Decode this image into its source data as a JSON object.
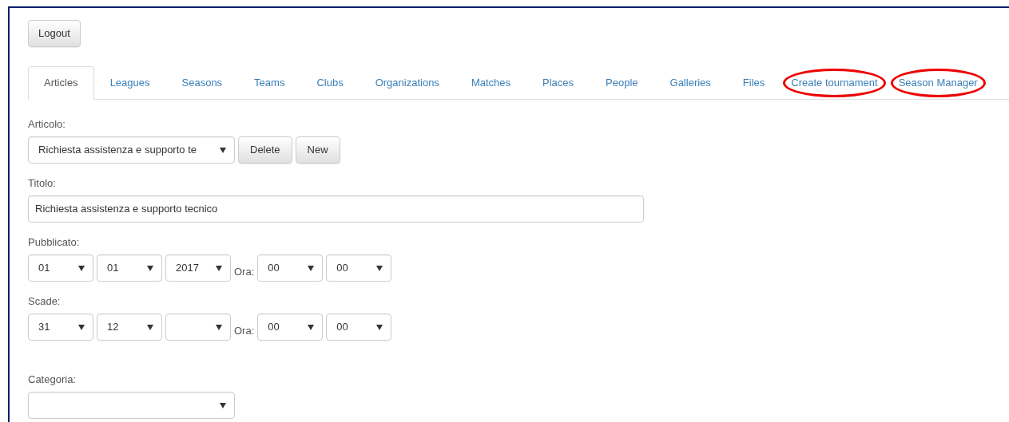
{
  "logout_button": {
    "label": "Logout"
  },
  "tabs": [
    {
      "label": "Articles",
      "selected": true,
      "highlighted": false
    },
    {
      "label": "Leagues",
      "selected": false,
      "highlighted": false
    },
    {
      "label": "Seasons",
      "selected": false,
      "highlighted": false
    },
    {
      "label": "Teams",
      "selected": false,
      "highlighted": false
    },
    {
      "label": "Clubs",
      "selected": false,
      "highlighted": false
    },
    {
      "label": "Organizations",
      "selected": false,
      "highlighted": false
    },
    {
      "label": "Matches",
      "selected": false,
      "highlighted": false
    },
    {
      "label": "Places",
      "selected": false,
      "highlighted": false
    },
    {
      "label": "People",
      "selected": false,
      "highlighted": false
    },
    {
      "label": "Galleries",
      "selected": false,
      "highlighted": false
    },
    {
      "label": "Files",
      "selected": false,
      "highlighted": false
    },
    {
      "label": "Create tournament",
      "selected": false,
      "highlighted": true
    },
    {
      "label": "Season Manager",
      "selected": false,
      "highlighted": true
    }
  ],
  "form": {
    "article": {
      "label": "Articolo:",
      "value": "Richiesta assistenza e supporto te",
      "buttons": [
        "Delete",
        "New"
      ]
    },
    "title": {
      "label": "Titolo:",
      "value": "Richiesta assistenza e supporto tecnico"
    },
    "published": {
      "label": "Pubblicato:",
      "date": [
        {
          "kind": "value",
          "value": "01"
        },
        {
          "kind": "value",
          "value": "01"
        },
        {
          "kind": "value",
          "value": "2017"
        }
      ],
      "time_label": "Ora:",
      "time": [
        {
          "value": "00"
        },
        {
          "value": "00"
        }
      ]
    },
    "expires": {
      "label": "Scade:",
      "date": [
        {
          "kind": "value",
          "value": "31"
        },
        {
          "kind": "value",
          "value": "12"
        },
        {
          "kind": "empty"
        }
      ],
      "time_label": "Ora:",
      "time": [
        {
          "value": "00"
        },
        {
          "value": "00"
        }
      ]
    },
    "category": {
      "label": "Categoria:"
    }
  }
}
